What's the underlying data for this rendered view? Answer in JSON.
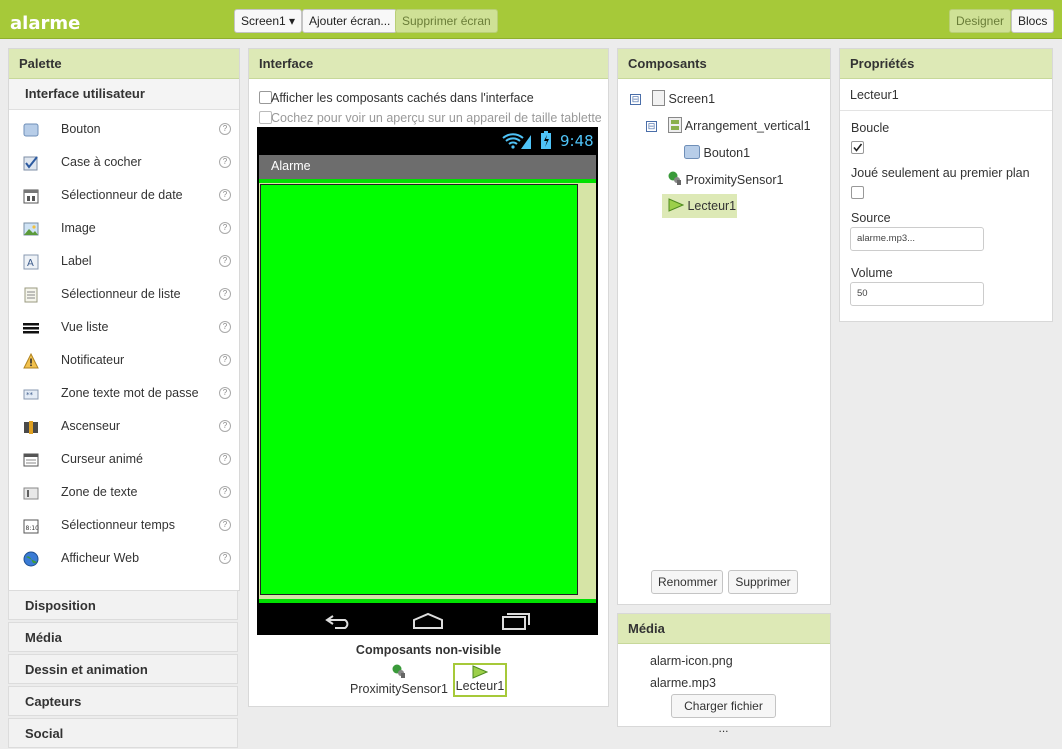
{
  "app": {
    "title": "alarme"
  },
  "topbar": {
    "screen_select": "Screen1 ▾",
    "add_screen": "Ajouter écran...",
    "remove_screen": "Supprimer écran",
    "designer": "Designer",
    "blocks": "Blocs"
  },
  "palette": {
    "title": "Palette",
    "section": "Interface utilisateur",
    "items": [
      {
        "label": "Bouton",
        "icon": "button-icon"
      },
      {
        "label": "Case à cocher",
        "icon": "checkbox-icon"
      },
      {
        "label": "Sélectionneur de date",
        "icon": "calendar-icon"
      },
      {
        "label": "Image",
        "icon": "image-icon"
      },
      {
        "label": "Label",
        "icon": "label-icon"
      },
      {
        "label": "Sélectionneur de liste",
        "icon": "list-picker-icon"
      },
      {
        "label": "Vue liste",
        "icon": "list-view-icon"
      },
      {
        "label": "Notificateur",
        "icon": "warning-icon"
      },
      {
        "label": "Zone texte mot de passe",
        "icon": "password-icon"
      },
      {
        "label": "Ascenseur",
        "icon": "slider-icon"
      },
      {
        "label": "Curseur animé",
        "icon": "spinner-icon"
      },
      {
        "label": "Zone de texte",
        "icon": "textbox-icon"
      },
      {
        "label": "Sélectionneur temps",
        "icon": "clock-icon"
      },
      {
        "label": "Afficheur Web",
        "icon": "globe-icon"
      }
    ],
    "help_glyph": "?",
    "drawers": [
      "Disposition",
      "Média",
      "Dessin et animation",
      "Capteurs",
      "Social"
    ]
  },
  "viewer": {
    "title": "Interface",
    "show_hidden": "Afficher les composants cachés dans l'interface",
    "tablet_preview": "Cochez pour voir un aperçu sur un appareil de taille tablette.",
    "phone_time": "9:48",
    "app_title": "Alarme",
    "nonvisible_title": "Composants non-visible",
    "nonvisible": [
      "ProximitySensor1",
      "Lecteur1"
    ]
  },
  "components": {
    "title": "Composants",
    "tree": [
      {
        "label": "Screen1",
        "toggle": "⊟"
      },
      {
        "label": "Arrangement_vertical1",
        "toggle": "⊟"
      },
      {
        "label": "Bouton1"
      },
      {
        "label": "ProximitySensor1"
      },
      {
        "label": "Lecteur1"
      }
    ],
    "rename": "Renommer",
    "delete": "Supprimer"
  },
  "media": {
    "title": "Média",
    "files": [
      "alarm-icon.png",
      "alarme.mp3"
    ],
    "upload": "Charger fichier ..."
  },
  "properties": {
    "title": "Propriétés",
    "component": "Lecteur1",
    "loop_label": "Boucle",
    "loop_checked": true,
    "foreground_label": "Joué seulement au premier plan",
    "foreground_checked": false,
    "source_label": "Source",
    "source_value": "alarme.mp3...",
    "volume_label": "Volume",
    "volume_value": "50"
  },
  "colors": {
    "accent": "#a6c939",
    "screen_green": "#00ff00",
    "selected": "#dde9b6"
  }
}
